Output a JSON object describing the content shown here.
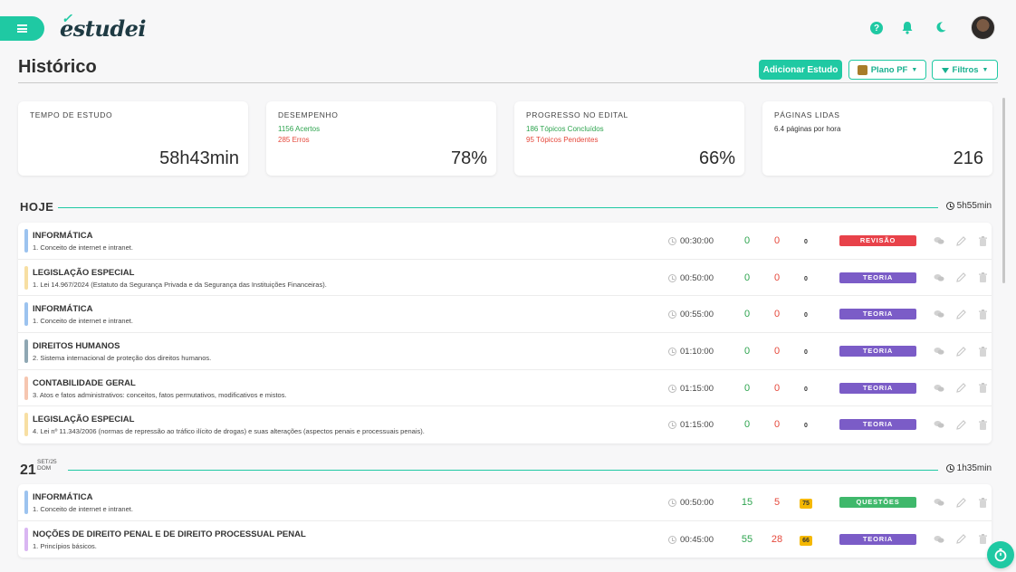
{
  "app": {
    "logo_text": "estudei"
  },
  "header": {
    "title": "Histórico",
    "add_button": "Adicionar Estudo",
    "plan_button": "Plano PF",
    "filter_button": "Filtros"
  },
  "stats": {
    "time": {
      "label": "TEMPO DE ESTUDO",
      "value": "58h43min"
    },
    "performance": {
      "label": "DESEMPENHO",
      "hits": "1156 Acertos",
      "errors": "285 Erros",
      "value": "78%"
    },
    "progress": {
      "label": "PROGRESSO NO EDITAL",
      "done": "186 Tópicos Concluídos",
      "pending": "95 Tópicos Pendentes",
      "value": "66%"
    },
    "pages": {
      "label": "PÁGINAS LIDAS",
      "rate": "6.4 páginas por hora",
      "value": "216"
    }
  },
  "today": {
    "label": "HOJE",
    "duration": "5h55min",
    "rows": [
      {
        "subject": "INFORMÁTICA",
        "topic": "1. Conceito de internet e intranet.",
        "time": "00:30:00",
        "correct": "0",
        "wrong": "0",
        "pct": "0",
        "tag": "REVISÃO",
        "bar_color": "#9cc3ef",
        "tag_color": "#e8424a"
      },
      {
        "subject": "LEGISLAÇÃO ESPECIAL",
        "topic": "1. Lei 14.967/2024 (Estatuto da Segurança Privada e da Segurança das Instituições Financeiras).",
        "time": "00:50:00",
        "correct": "0",
        "wrong": "0",
        "pct": "0",
        "tag": "TEORIA",
        "bar_color": "#f7dfa3",
        "tag_color": "#7b5cc7"
      },
      {
        "subject": "INFORMÁTICA",
        "topic": "1. Conceito de internet e intranet.",
        "time": "00:55:00",
        "correct": "0",
        "wrong": "0",
        "pct": "0",
        "tag": "TEORIA",
        "bar_color": "#9cc3ef",
        "tag_color": "#7b5cc7"
      },
      {
        "subject": "DIREITOS HUMANOS",
        "topic": "2. Sistema internacional de proteção dos direitos humanos.",
        "time": "01:10:00",
        "correct": "0",
        "wrong": "0",
        "pct": "0",
        "tag": "TEORIA",
        "bar_color": "#8fa7b3",
        "tag_color": "#7b5cc7"
      },
      {
        "subject": "CONTABILIDADE GERAL",
        "topic": "3. Atos e fatos administrativos: conceitos, fatos permutativos, modificativos e mistos.",
        "time": "01:15:00",
        "correct": "0",
        "wrong": "0",
        "pct": "0",
        "tag": "TEORIA",
        "bar_color": "#f6c6b0",
        "tag_color": "#7b5cc7"
      },
      {
        "subject": "LEGISLAÇÃO ESPECIAL",
        "topic": "4. Lei nº 11.343/2006 (normas de repressão ao tráfico ilícito de drogas) e suas alterações (aspectos penais e processuais penais).",
        "time": "01:15:00",
        "correct": "0",
        "wrong": "0",
        "pct": "0",
        "tag": "TEORIA",
        "bar_color": "#f7dfa3",
        "tag_color": "#7b5cc7"
      }
    ]
  },
  "day2": {
    "day": "21",
    "month": "SET/25",
    "weekday": "DOM",
    "duration": "1h35min",
    "rows": [
      {
        "subject": "INFORMÁTICA",
        "topic": "1. Conceito de internet e intranet.",
        "time": "00:50:00",
        "correct": "15",
        "wrong": "5",
        "pct": "75",
        "tag": "QUESTÕES",
        "bar_color": "#9cc3ef",
        "tag_color": "#3fb86b"
      },
      {
        "subject": "NOÇÕES DE DIREITO PENAL E DE DIREITO PROCESSUAL PENAL",
        "topic": "1. Princípios básicos.",
        "time": "00:45:00",
        "correct": "55",
        "wrong": "28",
        "pct": "66",
        "tag": "TEORIA",
        "bar_color": "#d9b6f2",
        "tag_color": "#7b5cc7"
      }
    ]
  },
  "colors": {
    "accent": "#1fc9a3",
    "correct": "#2ea44f",
    "wrong": "#e5483b",
    "highlight": "#f5b800"
  },
  "icons": [
    "menu-icon",
    "help-icon",
    "bell-icon",
    "moon-icon",
    "clock-icon",
    "comment-icon",
    "edit-icon",
    "trash-icon",
    "stopwatch-icon",
    "funnel-icon",
    "chevron-down-icon"
  ]
}
